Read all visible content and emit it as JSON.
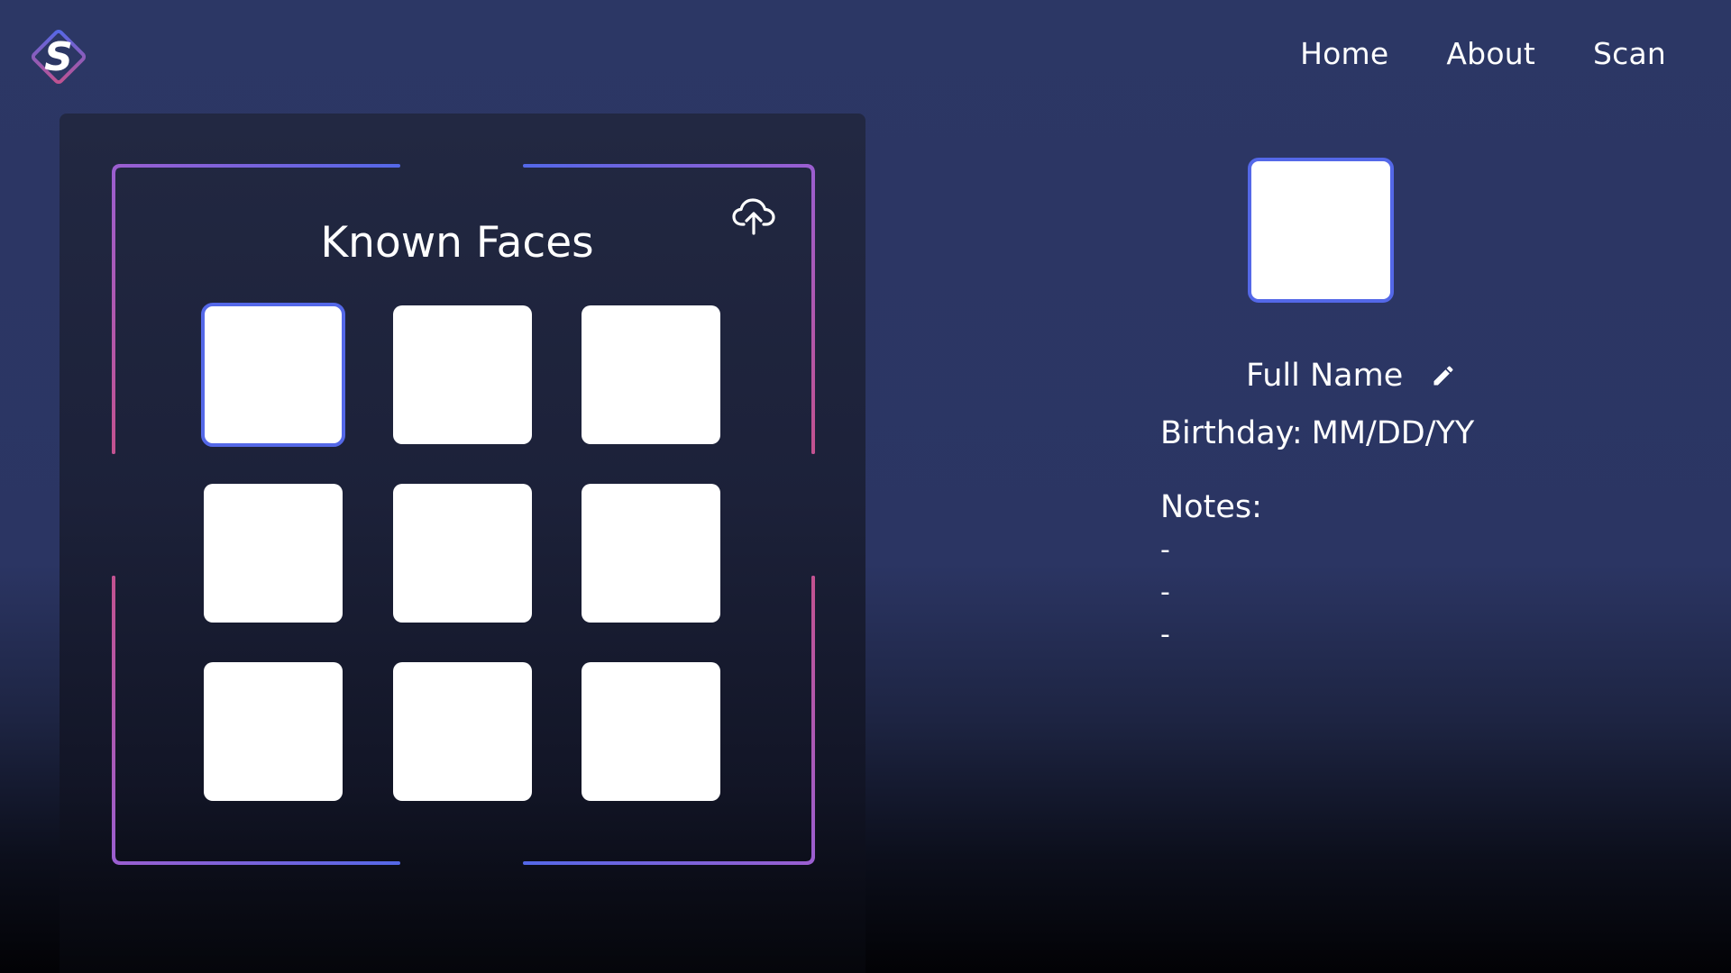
{
  "header": {
    "logo": {
      "icon": "s-diamond-logo-icon",
      "letter": "S"
    },
    "nav": [
      {
        "label": "Home"
      },
      {
        "label": "About"
      },
      {
        "label": "Scan"
      }
    ]
  },
  "known_faces": {
    "title": "Known Faces",
    "upload_icon": "cloud-upload-icon",
    "selected_index": 0,
    "faces": [
      {
        "id": 1
      },
      {
        "id": 2
      },
      {
        "id": 3
      },
      {
        "id": 4
      },
      {
        "id": 5
      },
      {
        "id": 6
      },
      {
        "id": 7
      },
      {
        "id": 8
      },
      {
        "id": 9
      }
    ]
  },
  "profile": {
    "full_name": "Full Name",
    "edit_icon": "pencil-icon",
    "birthday_label": "Birthday:",
    "birthday_value": "MM/DD/YY",
    "notes_label": "Notes:",
    "notes": [
      "-",
      "-",
      "-"
    ]
  },
  "colors": {
    "accent_blue": "#5468e8",
    "accent_pink": "#c2528f",
    "accent_purple": "#9a5ed0",
    "background_top": "#2c3765"
  }
}
